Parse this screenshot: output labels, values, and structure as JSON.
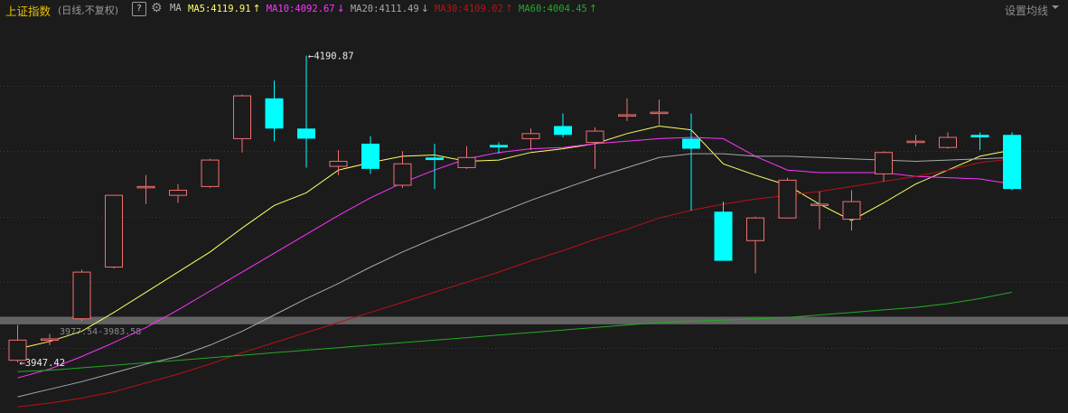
{
  "header": {
    "index_name": "上证指数",
    "period": "(日线,不复权)",
    "help_icon": "?",
    "ma_label": "MA",
    "ma": [
      {
        "label": "MA5:4119.91",
        "arrow": "↑",
        "color": "#ffff66",
        "arrow_color": "#ffff66"
      },
      {
        "label": "MA10:4092.67",
        "arrow": "↓",
        "color": "#ff33ff",
        "arrow_color": "#ff33ff"
      },
      {
        "label": "MA20:4111.49",
        "arrow": "↓",
        "color": "#a8a8a8",
        "arrow_color": "#a8a8a8"
      },
      {
        "label": "MA30:4109.02",
        "arrow": "↑",
        "color": "#bb1111",
        "arrow_color": "#bb1111"
      },
      {
        "label": "MA60:4004.45",
        "arrow": "↑",
        "color": "#22aa22",
        "arrow_color": "#22aa22"
      }
    ],
    "settings_label": "设置均线",
    "settings_caret_icon": "chevron-down-icon"
  },
  "colors": {
    "background": "#1b1b1c",
    "up": "#f07070",
    "down": "#00ffff",
    "grid": "#3a3a3a",
    "band": "#707070"
  },
  "chart_data": {
    "type": "candlestick",
    "ylim": [
      3910,
      4215
    ],
    "candles": [
      {
        "o": 3949,
        "c": 3965,
        "h": 3977,
        "l": 3947.42
      },
      {
        "o": 3966,
        "c": 3966,
        "h": 3970,
        "l": 3961
      },
      {
        "o": 3982,
        "c": 4019,
        "h": 4021,
        "l": 3980
      },
      {
        "o": 4023,
        "c": 4080,
        "h": 4080,
        "l": 4022
      },
      {
        "o": 4086,
        "c": 4087,
        "h": 4096,
        "l": 4073
      },
      {
        "o": 4080,
        "c": 4084,
        "h": 4089,
        "l": 4074
      },
      {
        "o": 4087,
        "c": 4108,
        "h": 4109,
        "l": 4086
      },
      {
        "o": 4125,
        "c": 4159,
        "h": 4160,
        "l": 4114
      },
      {
        "o": 4157,
        "c": 4133,
        "h": 4171,
        "l": 4123
      },
      {
        "o": 4133,
        "c": 4125,
        "h": 4190.87,
        "l": 4102
      },
      {
        "o": 4103,
        "c": 4107,
        "h": 4116,
        "l": 4096
      },
      {
        "o": 4121,
        "c": 4101,
        "h": 4127,
        "l": 4097
      },
      {
        "o": 4088,
        "c": 4105,
        "h": 4115,
        "l": 4086
      },
      {
        "o": 4110,
        "c": 4108,
        "h": 4121,
        "l": 4085
      },
      {
        "o": 4102,
        "c": 4110,
        "h": 4119,
        "l": 4101
      },
      {
        "o": 4120,
        "c": 4118,
        "h": 4122,
        "l": 4113
      },
      {
        "o": 4125,
        "c": 4129,
        "h": 4133,
        "l": 4116
      },
      {
        "o": 4135,
        "c": 4128,
        "h": 4145,
        "l": 4126
      },
      {
        "o": 4122,
        "c": 4131,
        "h": 4134,
        "l": 4101
      },
      {
        "o": 4144,
        "c": 4144,
        "h": 4157,
        "l": 4139
      },
      {
        "o": 4146,
        "c": 4146,
        "h": 4156,
        "l": 4136
      },
      {
        "o": 4125,
        "c": 4117,
        "h": 4145,
        "l": 4068
      },
      {
        "o": 4067,
        "c": 4028,
        "h": 4075,
        "l": 4028
      },
      {
        "o": 4044,
        "c": 4062,
        "h": 4063,
        "l": 4018
      },
      {
        "o": 4062,
        "c": 4092,
        "h": 4094,
        "l": 4062
      },
      {
        "o": 4073,
        "c": 4073,
        "h": 4083,
        "l": 4053
      },
      {
        "o": 4061,
        "c": 4075,
        "h": 4084,
        "l": 4052
      },
      {
        "o": 4097,
        "c": 4114,
        "h": 4115,
        "l": 4091
      },
      {
        "o": 4122,
        "c": 4123,
        "h": 4128,
        "l": 4119
      },
      {
        "o": 4118,
        "c": 4126,
        "h": 4130,
        "l": 4117
      },
      {
        "o": 4128,
        "c": 4126,
        "h": 4130,
        "l": 4116
      },
      {
        "o": 4128,
        "c": 4085,
        "h": 4130,
        "l": 4084
      }
    ],
    "ma": [
      {
        "name": "MA5",
        "color": "#ffff66",
        "values": [
          3958,
          3964,
          3972,
          3987,
          4003,
          4019,
          4035,
          4054,
          4072,
          4082,
          4100,
          4106,
          4111,
          4112,
          4107,
          4108,
          4114,
          4117,
          4121,
          4129,
          4135,
          4132,
          4105,
          4096,
          4088,
          4073,
          4060,
          4074,
          4089,
          4100,
          4111,
          4116
        ]
      },
      {
        "name": "MA10",
        "color": "#ff33ff",
        "values": [
          3935,
          3942,
          3952,
          3963,
          3975,
          3989,
          4004,
          4019,
          4034,
          4049,
          4064,
          4078,
          4090,
          4100,
          4109,
          4114,
          4117,
          4118,
          4121,
          4123,
          4125,
          4126,
          4125,
          4111,
          4100,
          4098,
          4098,
          4098,
          4095,
          4094,
          4093,
          4089
        ]
      },
      {
        "name": "MA20",
        "color": "#a8a8a8",
        "values": [
          3920,
          3926,
          3932,
          3939,
          3946,
          3952,
          3961,
          3972,
          3985,
          3998,
          4010,
          4023,
          4035,
          4046,
          4056,
          4066,
          4076,
          4085,
          4094,
          4102,
          4110,
          4113,
          4113,
          4111,
          4111,
          4110,
          4109,
          4108,
          4107,
          4108,
          4109,
          4110
        ]
      },
      {
        "name": "MA30",
        "color": "#bb1111",
        "values": [
          3912,
          3915,
          3919,
          3924,
          3931,
          3938,
          3946,
          3955,
          3963,
          3971,
          3979,
          3987,
          3995,
          4003,
          4011,
          4019,
          4028,
          4036,
          4045,
          4053,
          4062,
          4068,
          4073,
          4077,
          4080,
          4083,
          4087,
          4091,
          4095,
          4100,
          4106,
          4109
        ]
      },
      {
        "name": "MA60",
        "color": "#22aa22",
        "values": [
          3940,
          3941,
          3943,
          3945,
          3947,
          3949,
          3951,
          3953,
          3955,
          3957,
          3959,
          3961,
          3963,
          3965,
          3967,
          3969,
          3971,
          3973,
          3975,
          3977,
          3979,
          3980,
          3981,
          3982,
          3983,
          3985,
          3987,
          3989,
          3991,
          3994,
          3998,
          4003
        ]
      }
    ],
    "band": {
      "low": 3977.54,
      "high": 3983.58,
      "label": "3977.54-3983.58"
    },
    "annotations": [
      {
        "index": 9,
        "value": 4190.87,
        "label": "←4190.87"
      },
      {
        "index": 0,
        "value": 3947.42,
        "label": "←3947.42"
      }
    ],
    "grid": true
  }
}
